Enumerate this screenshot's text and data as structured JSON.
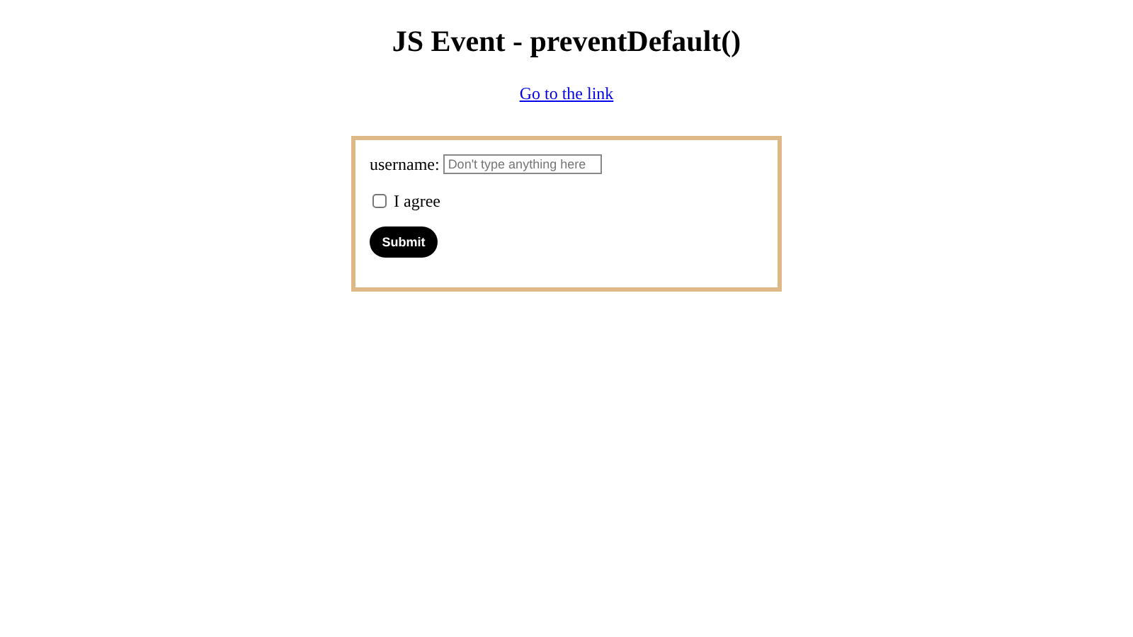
{
  "title": "JS Event - preventDefault()",
  "link": "Go to the link",
  "form": {
    "username_label": "username:",
    "username_placeholder": "Don't type anything here",
    "checkbox": {
      "label": "I agree",
      "checked": false
    },
    "submit": "Submit"
  }
}
